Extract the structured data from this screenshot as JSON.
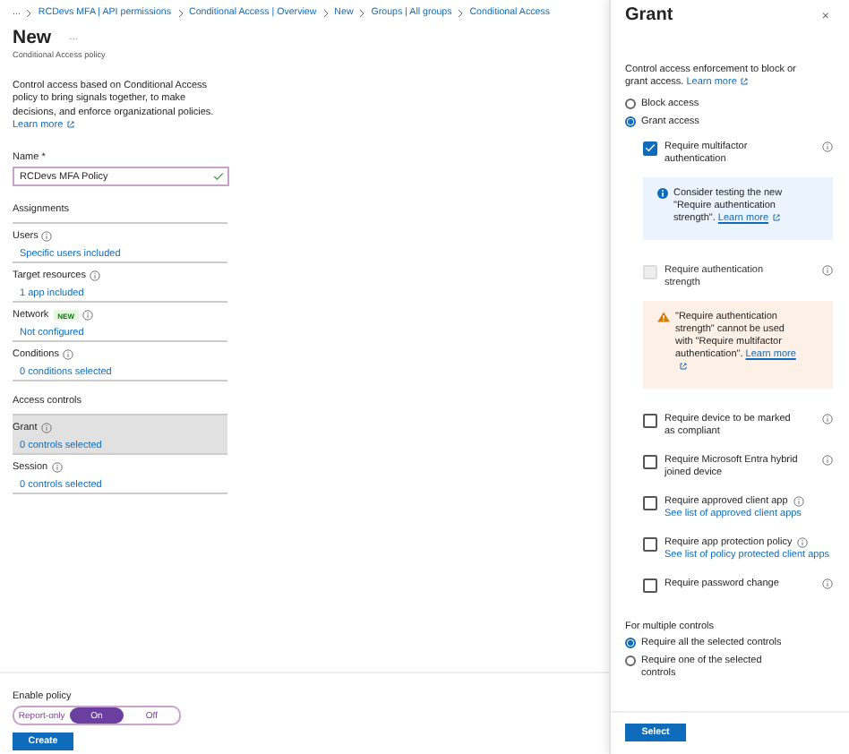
{
  "breadcrumb": [
    "...",
    "RCDevs MFA | API permissions",
    "Conditional Access | Overview",
    "New",
    "Groups | All groups",
    "Conditional Access"
  ],
  "page": {
    "title": "New",
    "more": "...",
    "subtitle": "Conditional Access policy",
    "description": "Control access based on Conditional Access policy to bring signals together, to make decisions, and enforce organizational policies.",
    "learn_more": "Learn more"
  },
  "name_field": {
    "label": "Name *",
    "value": "RCDevs MFA Policy",
    "valid": true
  },
  "sections": [
    {
      "heading": "Assignments",
      "items": [
        {
          "label": "Users",
          "value": "Specific users included",
          "selected": false
        },
        {
          "label": "Target resources",
          "value": "1 app included",
          "selected": false
        },
        {
          "label": "Network",
          "badge": "NEW",
          "value": "Not configured",
          "selected": false
        },
        {
          "label": "Conditions",
          "value": "0 conditions selected",
          "selected": false
        }
      ]
    },
    {
      "heading": "Access controls",
      "items": [
        {
          "label": "Grant",
          "value": "0 controls selected",
          "selected": true
        },
        {
          "label": "Session",
          "value": "0 controls selected",
          "selected": false
        }
      ]
    }
  ],
  "enable_policy": {
    "label": "Enable policy",
    "options": [
      {
        "label": "Report-only",
        "selected": false
      },
      {
        "label": "On",
        "selected": true
      },
      {
        "label": "Off",
        "selected": false
      }
    ]
  },
  "create_button": "Create",
  "grant_panel": {
    "title": "Grant",
    "close": "×",
    "description": "Control access enforcement to block or grant access.",
    "learn_more": "Learn more",
    "access": [
      {
        "label": "Block access",
        "selected": false
      },
      {
        "label": "Grant access",
        "selected": true
      }
    ],
    "controls": [
      {
        "kind": "checkbox",
        "label": "Require multifactor authentication",
        "checked": true,
        "disabled": false
      },
      {
        "kind": "info",
        "text": "Consider testing the new \"Require authentication strength\".",
        "link": "Learn more"
      },
      {
        "kind": "checkbox",
        "label": "Require authentication strength",
        "checked": false,
        "disabled": true
      },
      {
        "kind": "warning",
        "text": "\"Require authentication strength\" cannot be used with \"Require multifactor authentication\".",
        "link": "Learn more"
      },
      {
        "kind": "checkbox",
        "label": "Require device to be marked as compliant",
        "checked": false,
        "disabled": false
      },
      {
        "kind": "checkbox",
        "label": "Require Microsoft Entra hybrid joined device",
        "checked": false,
        "disabled": false
      },
      {
        "kind": "checkbox",
        "label": "Require approved client app",
        "link": "See list of approved client apps",
        "checked": false,
        "disabled": false
      },
      {
        "kind": "checkbox",
        "label": "Require app protection policy",
        "link": "See list of policy protected client apps",
        "checked": false,
        "disabled": false
      },
      {
        "kind": "checkbox",
        "label": "Require password change",
        "checked": false,
        "disabled": false
      }
    ],
    "multiple": {
      "label": "For multiple controls",
      "options": [
        {
          "label": "Require all the selected controls",
          "selected": true
        },
        {
          "label": "Require one of the selected controls",
          "selected": false
        }
      ]
    },
    "select_button": "Select"
  }
}
